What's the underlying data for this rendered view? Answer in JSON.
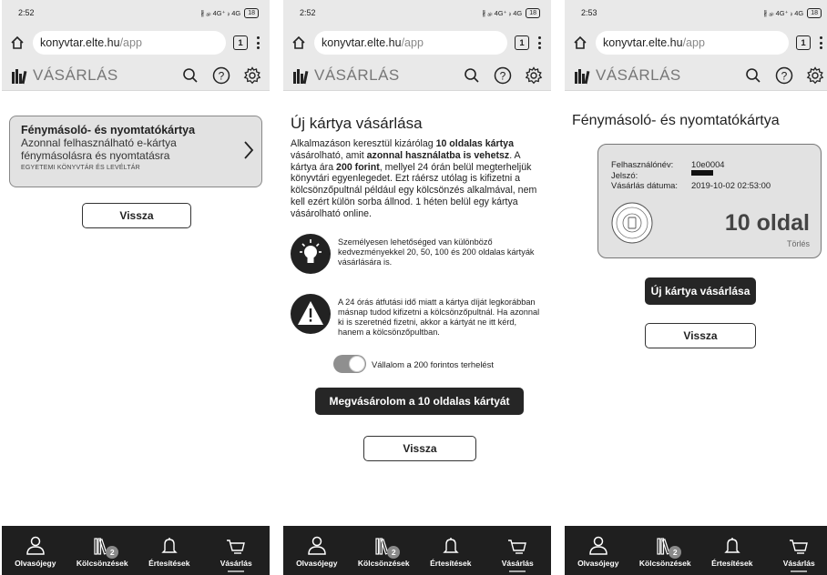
{
  "colors": {
    "accent_dark": "#262626",
    "chrome_bg": "#e9e9e9",
    "nav_bg": "#1f1f1f"
  },
  "screens": [
    {
      "status": {
        "time": "2:52",
        "indicators": "∦ ₐᵢₗ 4G⁺ ᵢₗ 4G",
        "battery": "18"
      },
      "browser": {
        "domain": "konyvtar.elte.hu",
        "path": "/app",
        "tab_count": "1"
      },
      "header": {
        "title": "VÁSÁRLÁS"
      }
    },
    {
      "status": {
        "time": "2:52",
        "indicators": "∦ ₐᵢₗ 4G⁺ ᵢₗ 4G",
        "battery": "18"
      },
      "browser": {
        "domain": "konyvtar.elte.hu",
        "path": "/app",
        "tab_count": "1"
      },
      "header": {
        "title": "VÁSÁRLÁS"
      }
    },
    {
      "status": {
        "time": "2:53",
        "indicators": "∦ ₐᵢₗ 4G⁺ ᵢₗ 4G",
        "battery": "18"
      },
      "browser": {
        "domain": "konyvtar.elte.hu",
        "path": "/app",
        "tab_count": "1"
      },
      "header": {
        "title": "VÁSÁRLÁS"
      }
    }
  ],
  "nav": [
    {
      "label": "Olvasójegy",
      "icon": "person-icon"
    },
    {
      "label": "Kölcsönzések",
      "icon": "books-icon",
      "badge": "2"
    },
    {
      "label": "Értesítések",
      "icon": "bell-icon"
    },
    {
      "label": "Vásárlás",
      "icon": "cart-icon"
    }
  ],
  "panel1": {
    "card_title": "Fénymásoló- és nyomtatókártya",
    "card_desc_line1": "Azonnal felhasználható e-kártya",
    "card_desc_line2": "fénymásolásra és nyomtatásra",
    "card_source": "EGYETEMI KÖNYVTÁR ÉS LEVÉLTÁR",
    "back_label": "Vissza"
  },
  "panel2": {
    "title": "Új kártya vásárlása",
    "p1": "Alkalmazáson keresztül kizárólag ",
    "p1_b": "10 oldalas kártya",
    "p2": " vásárolható, amit ",
    "p2_b": "azonnal használatba is vehetsz",
    "p3": ". A kártya ára ",
    "p3_b": "200 forint",
    "p4": ", mellyel 24 órán belül megterheljük könyvtári egyenlegedet. Ezt ráérsz utólag is kifizetni a kölcsönzőpultnál például egy kölcsönzés alkalmával, nem kell ezért külön sorba állnod. 1 héten belül egy kártya vásárolható online.",
    "info1": "Személyesen lehetőséged van különböző kedvezményekkel 20, 50, 100 és 200 oldalas kártyák vásárlására is.",
    "info2": "A 24 órás átfutási idő miatt a kártya díját legkorábban másnap tudod kifizetni a kölcsönzőpultnál. Ha azonnal ki is szeretnéd fizetni, akkor a kártyát ne itt kérd, hanem a kölcsönzőpultban.",
    "toggle_label": "Vállalom a 200 forintos terhelést",
    "buy_label": "Megvásárolom a 10 oldalas kártyát",
    "back_label": "Vissza"
  },
  "panel3": {
    "title": "Fénymásoló- és nyomtatókártya",
    "username_label": "Felhasználónév:",
    "username_value": "10e0004",
    "password_label": "Jelszó:",
    "date_label": "Vásárlás dátuma:",
    "date_value": "2019-10-02 02:53:00",
    "pages": "10 oldal",
    "delete_label": "Törlés",
    "new_card_label": "Új kártya vásárlása",
    "back_label": "Vissza"
  }
}
